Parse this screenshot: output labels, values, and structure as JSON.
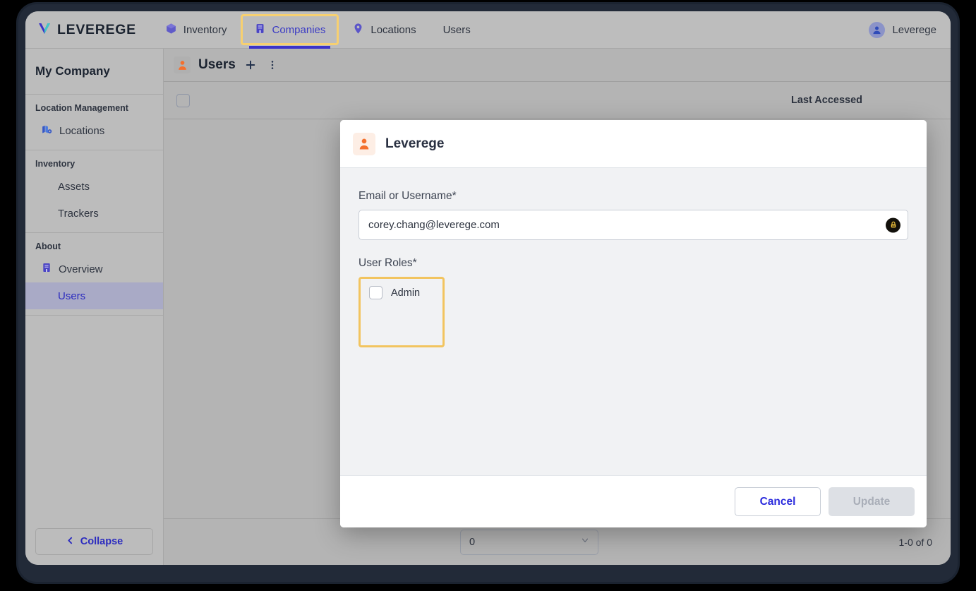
{
  "app": {
    "brand": "LEVEREGE",
    "user_menu_label": "Leverege"
  },
  "topnav": {
    "tabs": [
      {
        "label": "Inventory",
        "icon": "cube-icon",
        "active": false
      },
      {
        "label": "Companies",
        "icon": "building-icon",
        "active": true,
        "annotated": true
      },
      {
        "label": "Locations",
        "icon": "map-pin-icon",
        "active": false
      },
      {
        "label": "Users",
        "icon": "none",
        "active": false
      }
    ]
  },
  "sidebar": {
    "company_title": "My Company",
    "groups": [
      {
        "label": "Location Management",
        "items": [
          {
            "label": "Locations",
            "icon": "map-layers-icon",
            "selected": false,
            "indent": false
          }
        ]
      },
      {
        "label": "Inventory",
        "items": [
          {
            "label": "Assets",
            "icon": "none",
            "selected": false,
            "indent": true
          },
          {
            "label": "Trackers",
            "icon": "none",
            "selected": false,
            "indent": true
          }
        ]
      },
      {
        "label": "About",
        "items": [
          {
            "label": "Overview",
            "icon": "building-icon",
            "selected": false,
            "indent": false
          },
          {
            "label": "Users",
            "icon": "none",
            "selected": true,
            "indent": true
          }
        ]
      }
    ],
    "collapse_label": "Collapse",
    "collapse_icon": "chevron-left-icon"
  },
  "page": {
    "title": "Users",
    "title_icon": "person-icon",
    "add_icon": "plus-icon",
    "more_icon": "more-vertical-icon",
    "table": {
      "columns": [
        "Last Accessed"
      ]
    },
    "pagination": {
      "rows_per_page_value": "0",
      "rows_per_page_options": [
        "0"
      ],
      "range_label": "1-0 of 0",
      "chevron_icon": "chevron-down-icon"
    }
  },
  "modal": {
    "title": "Leverege",
    "title_icon": "person-icon",
    "fields": {
      "email": {
        "label": "Email or Username*",
        "value": "corey.chang@leverege.com",
        "placeholder": "Email or Username",
        "badge_icon": "lock-icon"
      },
      "roles": {
        "label": "User Roles*",
        "options": [
          {
            "label": "Admin",
            "checked": false
          }
        ]
      }
    },
    "buttons": {
      "cancel": "Cancel",
      "update": "Update"
    }
  },
  "colors": {
    "brand_blue": "#3b33c9",
    "link_blue": "#2b2bdd",
    "annotation_yellow": "#f2c45f",
    "accent_orange": "#f4702e",
    "chrome_gray": "#b4b4b4"
  }
}
